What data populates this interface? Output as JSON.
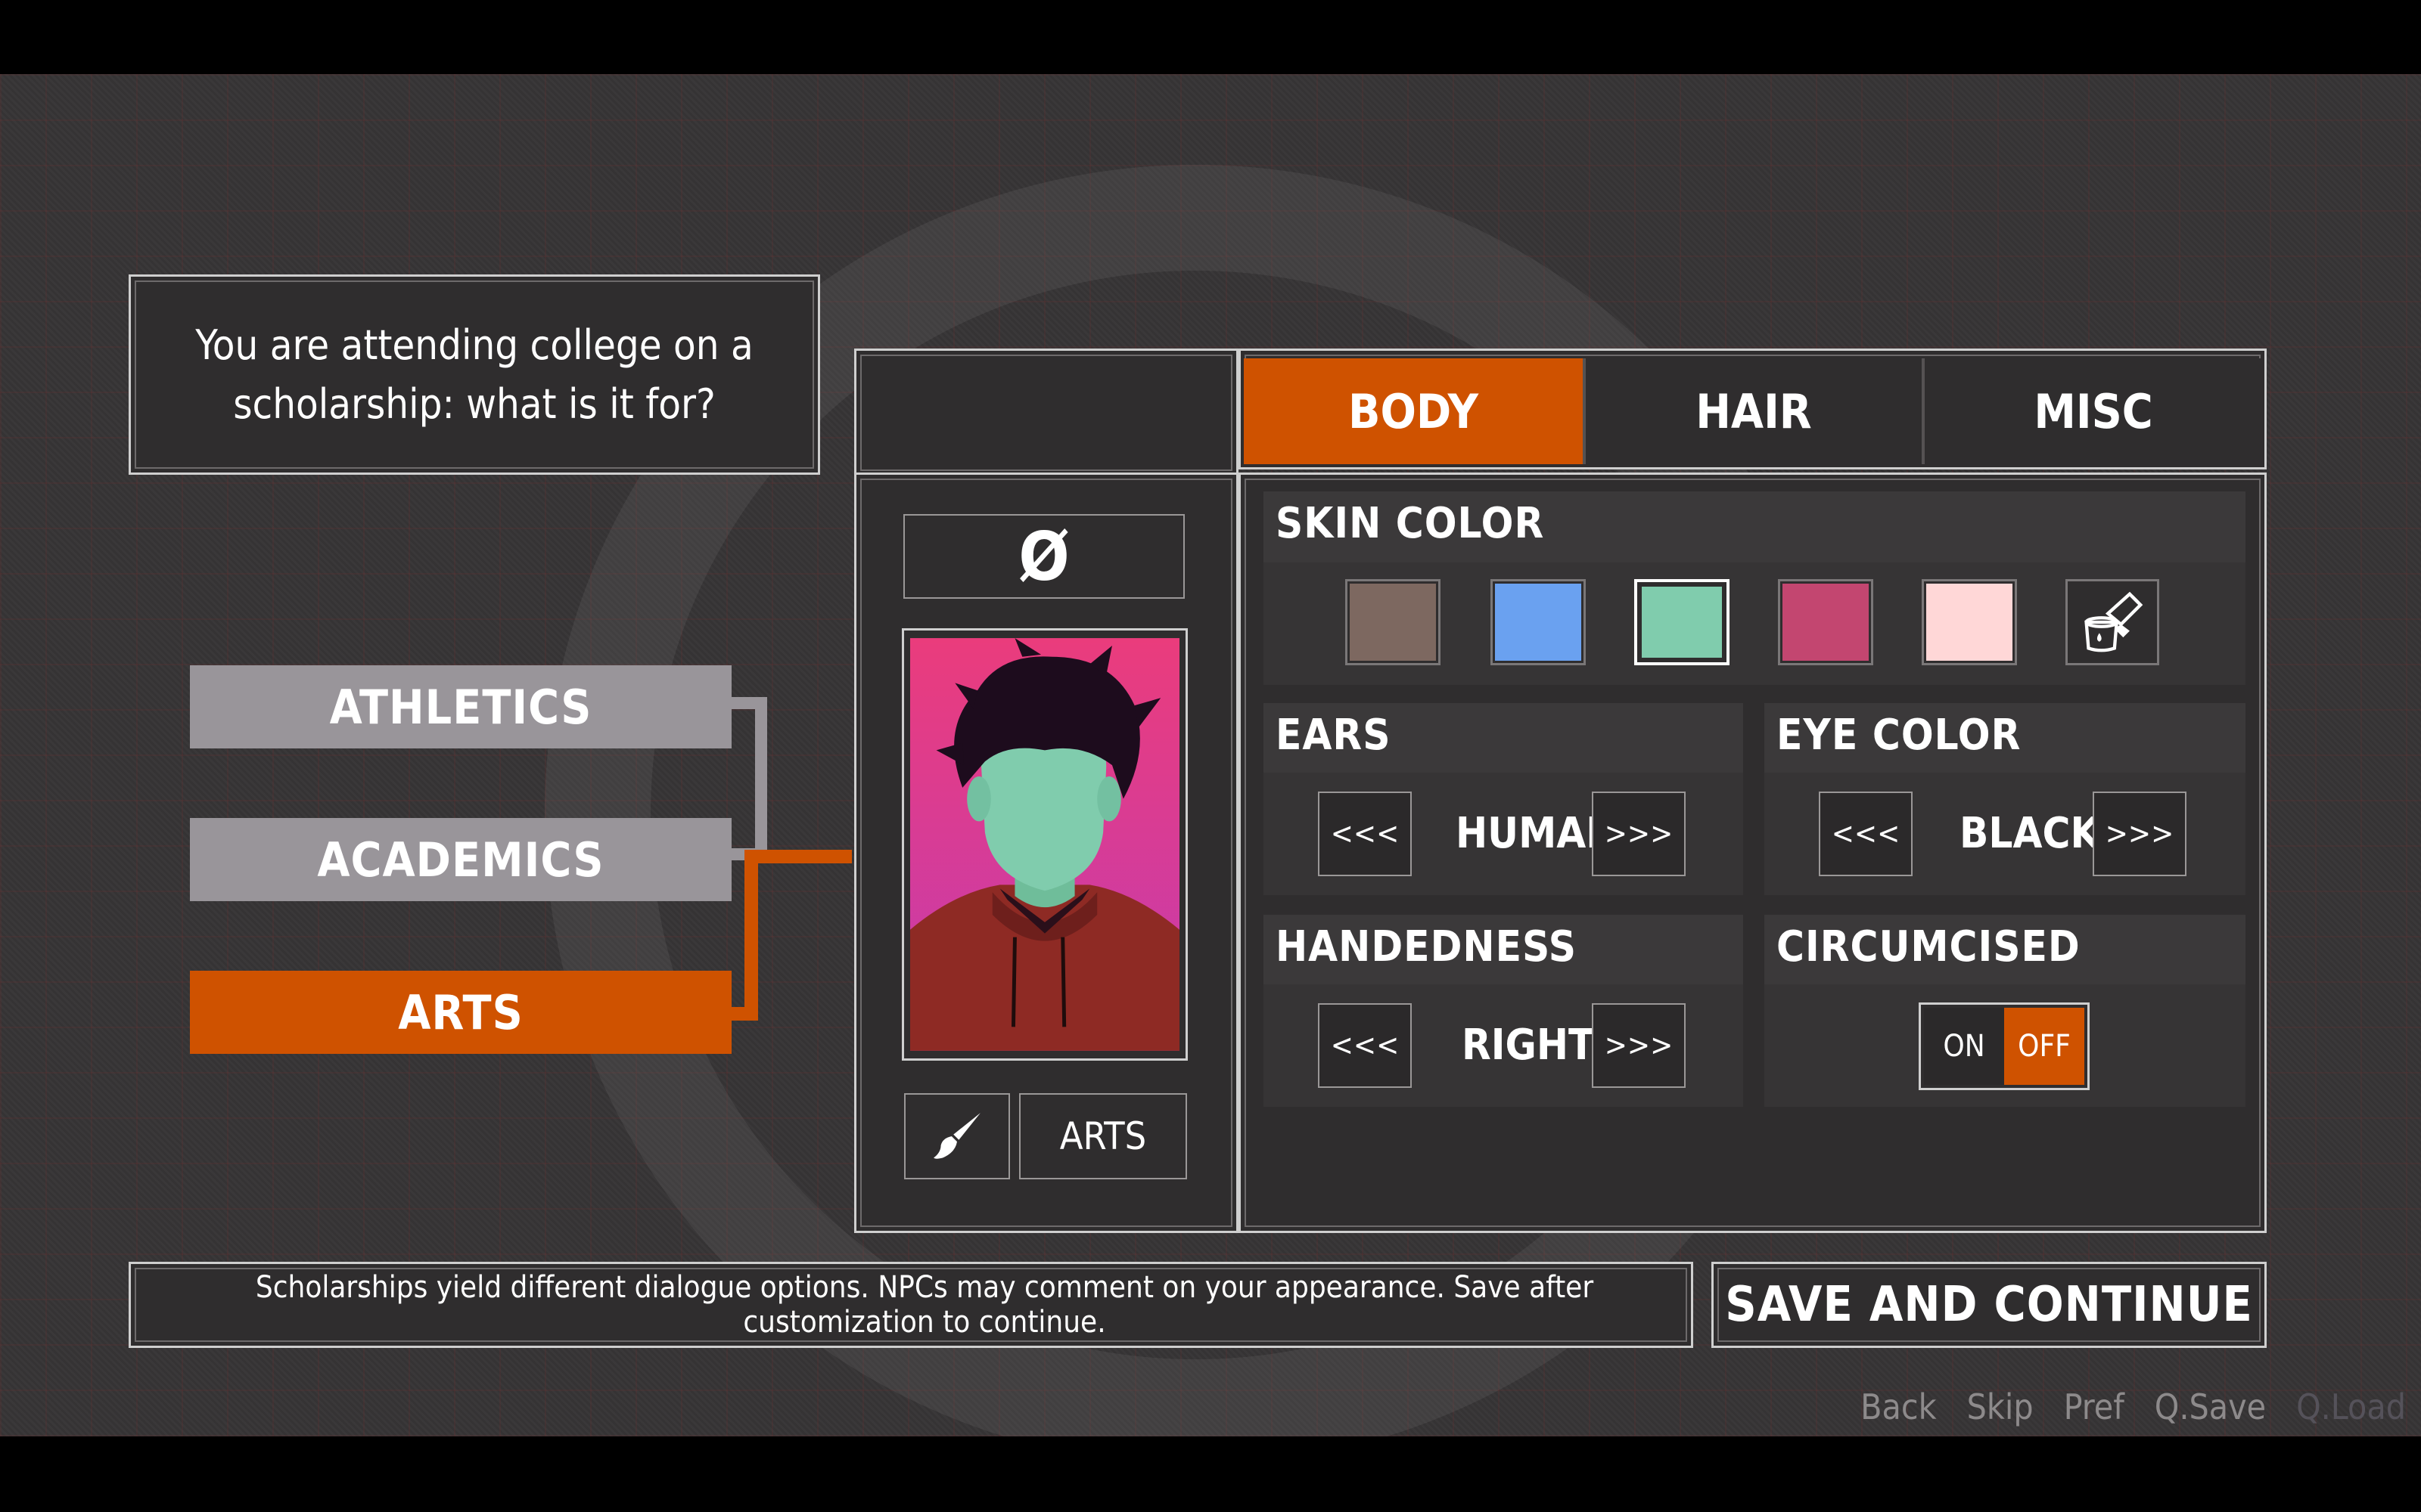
{
  "question": {
    "text": "You are attending college on a scholarship: what is it for?"
  },
  "choices": [
    {
      "label": "ATHLETICS",
      "selected": false
    },
    {
      "label": "ACADEMICS",
      "selected": false
    },
    {
      "label": "ARTS",
      "selected": true
    }
  ],
  "preview": {
    "null_symbol": "Ø",
    "brush_icon": "paintbrush-icon",
    "tag": "ARTS"
  },
  "tabs": [
    {
      "label": "BODY",
      "active": true
    },
    {
      "label": "HAIR",
      "active": false
    },
    {
      "label": "MISC",
      "active": false
    }
  ],
  "skin_color": {
    "title": "SKIN COLOR",
    "swatches": [
      "#7d6860",
      "#6aa1f0",
      "#80ccad",
      "#c34670",
      "#ffd7d7"
    ],
    "selected_index": 2,
    "custom_icon": "paint-bucket-icon"
  },
  "ears": {
    "title": "EARS",
    "prev": "<<<",
    "value": "HUMAN",
    "next": ">>>"
  },
  "eye_color": {
    "title": "EYE COLOR",
    "prev": "<<<",
    "value": "BLACK",
    "next": ">>>"
  },
  "handedness": {
    "title": "HANDEDNESS",
    "prev": "<<<",
    "value": "RIGHT",
    "next": ">>>"
  },
  "circumcised": {
    "title": "CIRCUMCISED",
    "on": "ON",
    "off": "OFF",
    "value": "OFF"
  },
  "hint": "Scholarships yield different dialogue options. NPCs may comment on your appearance. Save after customization to continue.",
  "save_button": "SAVE AND CONTINUE",
  "quick_menu": [
    "Back",
    "Skip",
    "Pref",
    "Q.Save",
    "Q.Load"
  ],
  "colors": {
    "accent": "#cf5200",
    "unselected_choice": "#99959a",
    "panel": "#2f2d2e"
  }
}
